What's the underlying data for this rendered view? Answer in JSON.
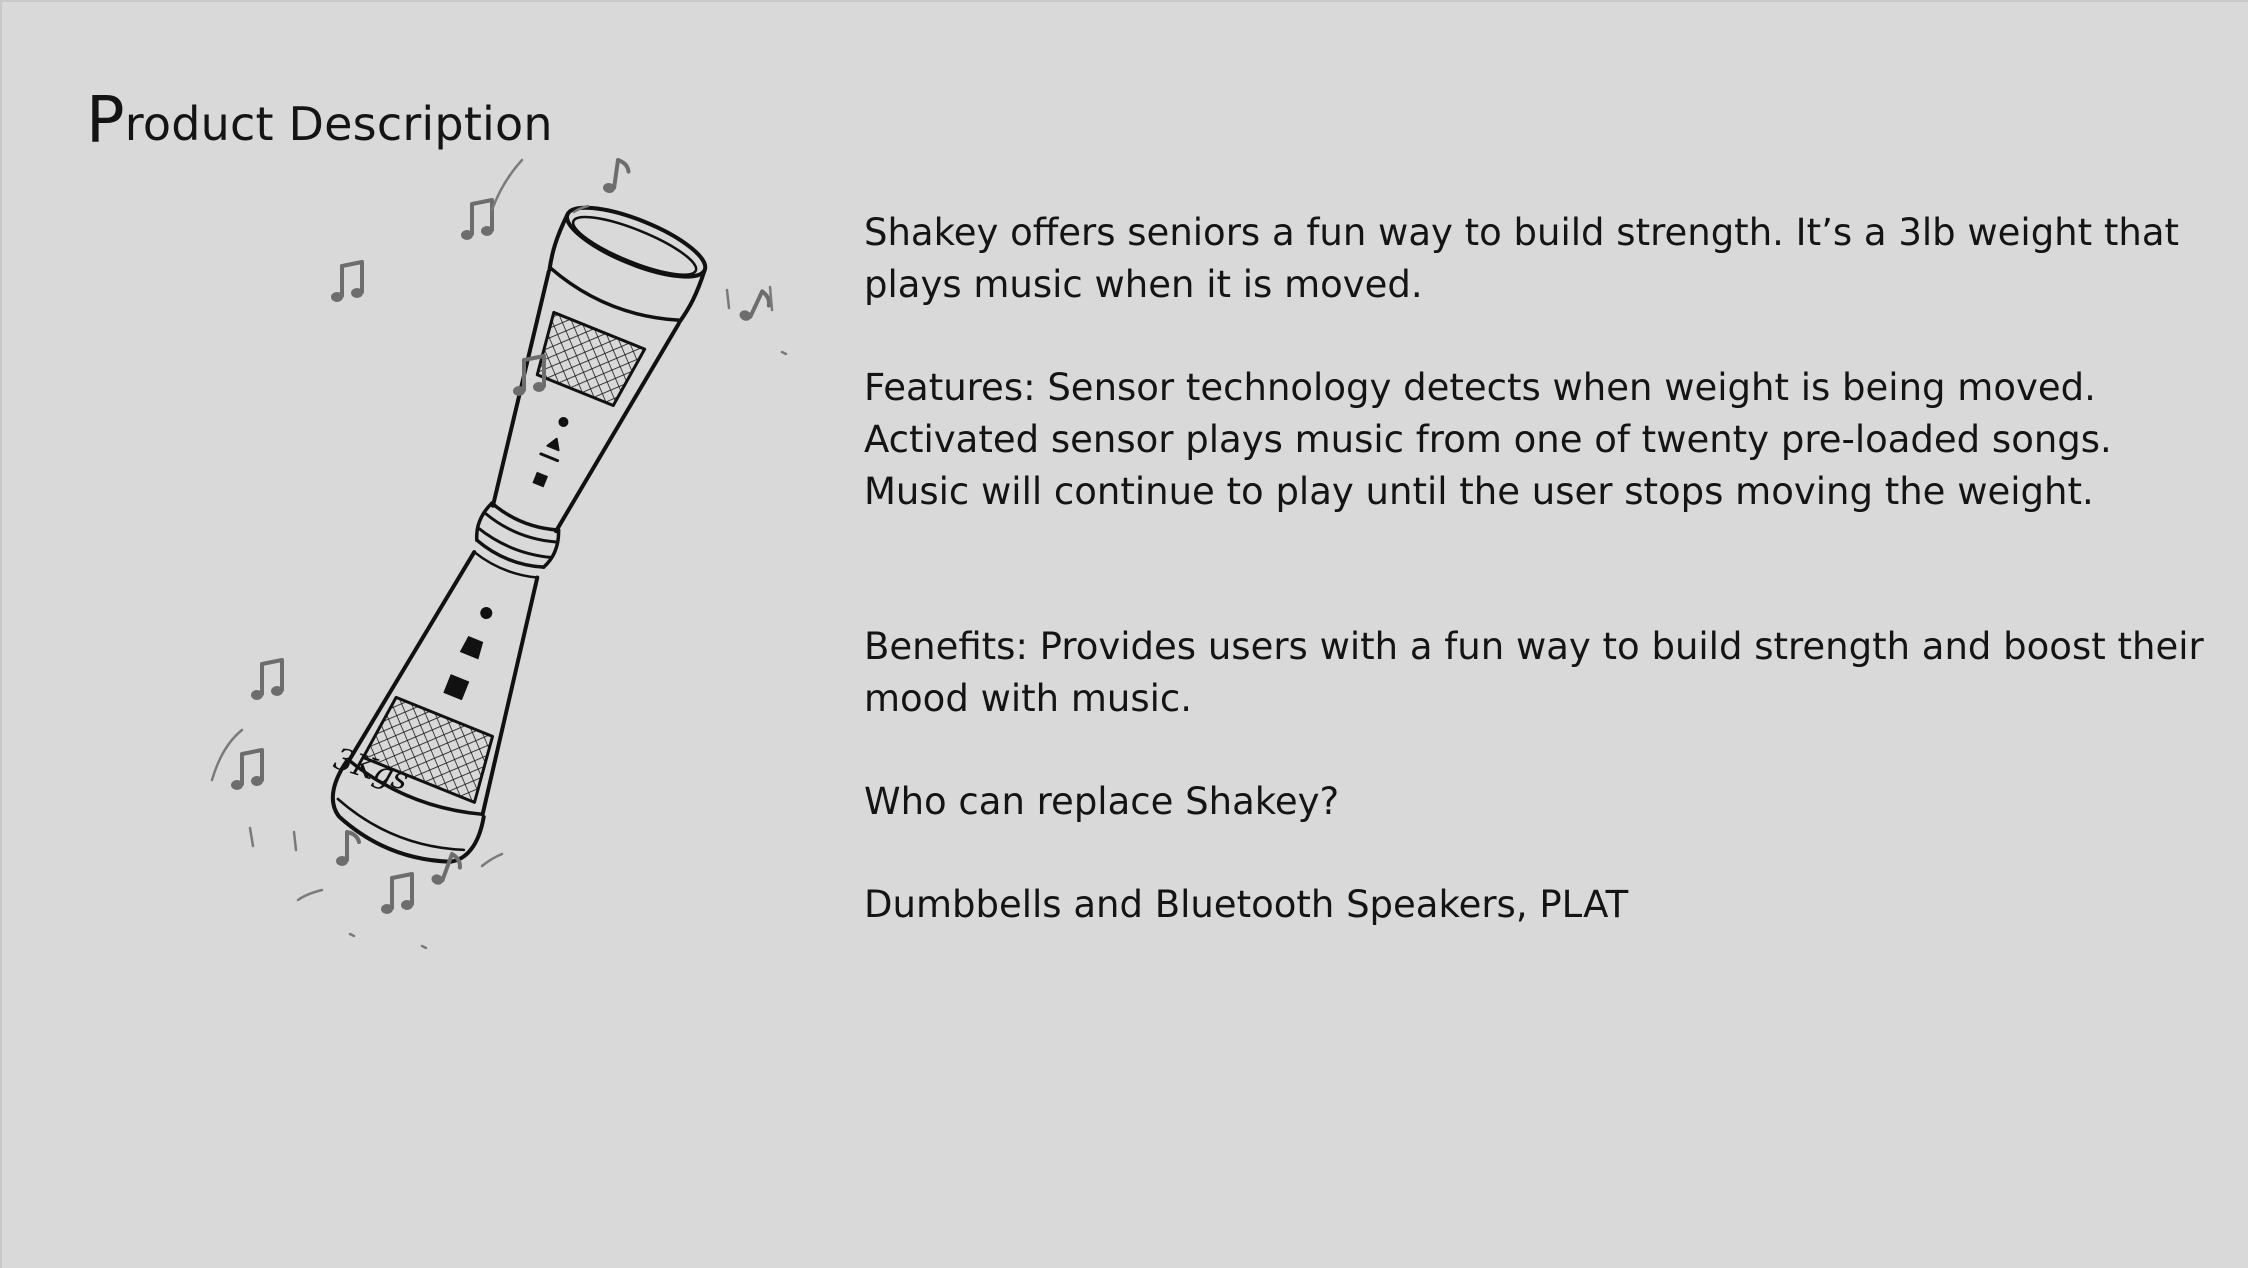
{
  "slide": {
    "title_initial": "P",
    "title_rest": "roduct Description"
  },
  "sketch": {
    "weight_label": "3Kgs",
    "icons": [
      "music-note-icon",
      "dumbbell-speaker-sketch"
    ]
  },
  "description": {
    "intro": "Shakey offers seniors a fun way to build strength. It’s a 3lb weight that plays music when it is moved.",
    "features": "Features: Sensor technology detects when weight is being moved. Activated sensor plays music from one of twenty pre-loaded songs. Music will continue to play until the user stops moving the weight.",
    "benefits": "Benefits: Provides users with a fun way to build strength and boost their mood with music.",
    "question": "Who can replace Shakey?",
    "answer": "Dumbbells and Bluetooth Speakers, PLAT"
  }
}
